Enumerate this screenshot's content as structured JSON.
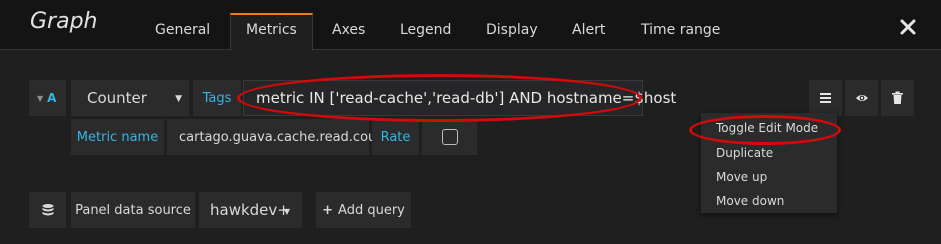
{
  "panel": {
    "title": "Graph"
  },
  "tabs": [
    {
      "label": "General"
    },
    {
      "label": "Metrics"
    },
    {
      "label": "Axes"
    },
    {
      "label": "Legend"
    },
    {
      "label": "Display"
    },
    {
      "label": "Alert"
    },
    {
      "label": "Time range"
    }
  ],
  "active_tab": "Metrics",
  "query": {
    "ref_id": "A",
    "aggregation": "Counter",
    "tags_label": "Tags",
    "tags_value": "metric IN ['read-cache','read-db'] AND hostname=$host",
    "metric_name_label": "Metric name",
    "metric_name_value": "cartago.guava.cache.read.count",
    "rate_label": "Rate",
    "rate_checked": false
  },
  "menu": {
    "items": [
      {
        "label": "Toggle Edit Mode"
      },
      {
        "label": "Duplicate"
      },
      {
        "label": "Move up"
      },
      {
        "label": "Move down"
      }
    ]
  },
  "footer": {
    "datasource_label": "Panel data source",
    "datasource_value": "hawkdev+",
    "add_query_label": "Add query"
  },
  "colors": {
    "accent": "#eb7b18",
    "link": "#33b5e5",
    "annotation": "#d10a0a"
  },
  "icons": [
    "close-icon",
    "hamburger-icon",
    "eye-icon",
    "trash-icon",
    "database-icon",
    "caret-down-icon",
    "plus-icon"
  ]
}
